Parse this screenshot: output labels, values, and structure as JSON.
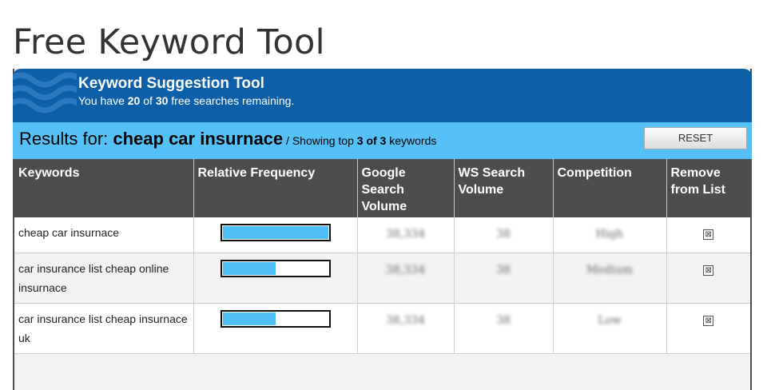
{
  "page": {
    "title": "Free Keyword Tool"
  },
  "header": {
    "title": "Keyword Suggestion Tool",
    "sub_prefix": "You have ",
    "searches_used": "20",
    "sub_mid": " of ",
    "searches_total": "30",
    "sub_suffix": " free searches remaining."
  },
  "results": {
    "label": "Results for: ",
    "query": "cheap car insurnace",
    "showing_prefix": " / Showing top ",
    "shown": "3 of 3",
    "showing_suffix": " keywords",
    "reset_label": "RESET"
  },
  "table": {
    "headers": {
      "keywords": "Keywords",
      "frequency": "Relative Frequency",
      "google_volume": "Google Search Volume",
      "ws_volume": "WS Search Volume",
      "competition": "Competition",
      "remove": "Remove from List"
    },
    "rows": [
      {
        "keyword": "cheap car insurnace",
        "frequency": 1.0,
        "google_volume": "38,334",
        "ws_volume": "38",
        "competition": "High",
        "remove": "⊠"
      },
      {
        "keyword": "car insurance list cheap online insurnace",
        "frequency": 0.5,
        "google_volume": "38,334",
        "ws_volume": "38",
        "competition": "Medium",
        "remove": "⊠"
      },
      {
        "keyword": "car insurance list cheap insurnace uk",
        "frequency": 0.5,
        "google_volume": "38,334",
        "ws_volume": "38",
        "competition": "Low",
        "remove": "⊠"
      }
    ]
  },
  "colors": {
    "header_blue": "#0d5fa8",
    "results_bar": "#55c0f5",
    "table_header": "#4d4d4d",
    "bar_fill": "#4fc0f5"
  }
}
